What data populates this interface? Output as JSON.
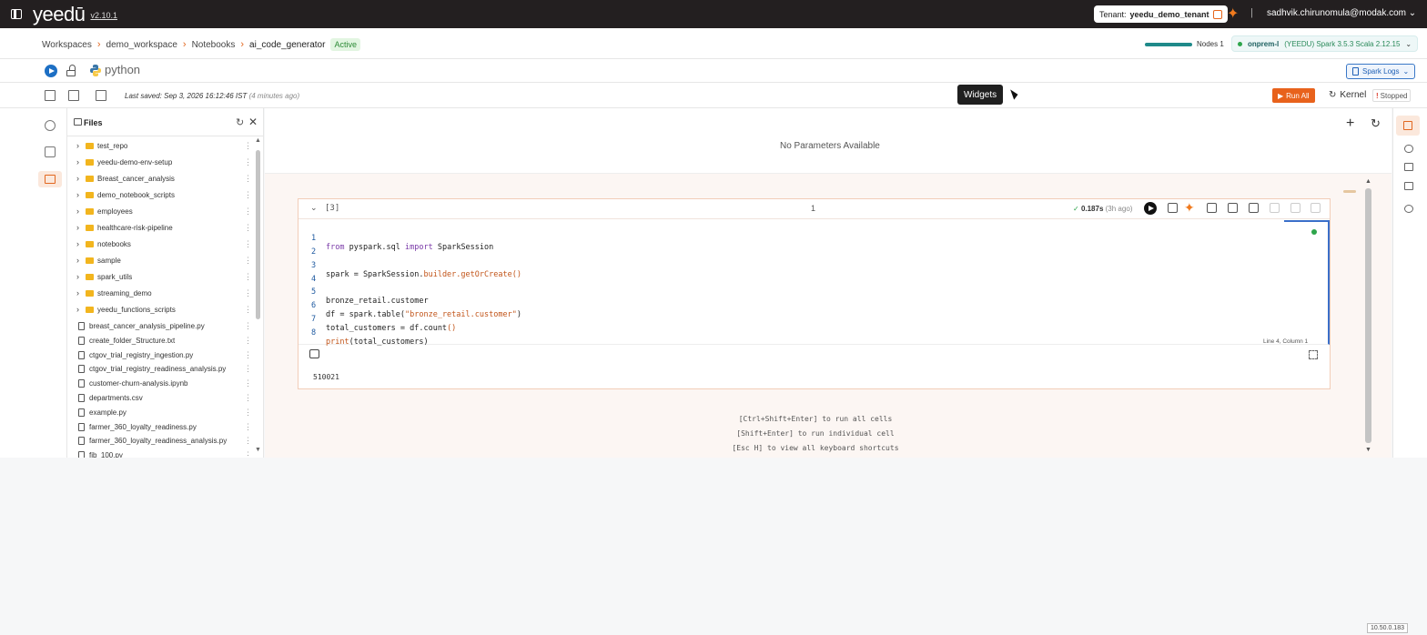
{
  "header": {
    "logo": "yeedū",
    "version": "v2.10.1",
    "tenant_label": "Tenant:",
    "tenant_name": "yeedu_demo_tenant",
    "separator": "|",
    "user": "sadhvik.chirunomula@modak.com",
    "user_caret": "⌄"
  },
  "breadcrumb": {
    "items": [
      "Workspaces",
      "demo_workspace",
      "Notebooks",
      "ai_code_generator"
    ],
    "separator": "›",
    "status": "Active"
  },
  "cluster": {
    "nodes_label": "Nodes 1",
    "name": "onprem-l",
    "version": "(YEEDU) Spark 3.5.3 Scala 2.12.15",
    "caret": "⌄"
  },
  "lang": {
    "label": "python",
    "spark_logs": "Spark Logs",
    "spark_logs_caret": "⌄"
  },
  "toolbar": {
    "last_saved": "Last saved: Sep 3, 2026 16:12:46 IST",
    "ago": "(4 minutes ago)",
    "tooltip": "Widgets",
    "run_all": "Run All",
    "run_all_icon": "▶",
    "kernel": "Kernel",
    "kernel_icon": "↻",
    "stopped": "Stopped",
    "stopped_mark": "!"
  },
  "files": {
    "title": "Files",
    "refresh_glyph": "↻",
    "close_glyph": "✕",
    "folders": [
      "test_repo",
      "yeedu-demo-env-setup",
      "Breast_cancer_analysis",
      "demo_notebook_scripts",
      "employees",
      "healthcare-risk-pipeline",
      "notebooks",
      "sample",
      "spark_utils",
      "streaming_demo",
      "yeedu_functions_scripts"
    ],
    "files": [
      "breast_cancer_analysis_pipeline.py",
      "create_folder_Structure.txt",
      "ctgov_trial_registry_ingestion.py",
      "ctgov_trial_registry_readiness_analysis.py",
      "customer-churn-analysis.ipynb",
      "departments.csv",
      "example.py",
      "farmer_360_loyalty_readiness.py",
      "farmer_360_loyalty_readiness_analysis.py",
      "fib_100.py"
    ],
    "caret": "›",
    "kebab": "⋮",
    "scroll_up": "▲",
    "scroll_down": "▼"
  },
  "params": {
    "empty_text": "No Parameters Available",
    "plus_glyph": "+",
    "reload_glyph": "↻"
  },
  "cell": {
    "collapse_glyph": "⌄",
    "exec_count": "[3]",
    "number": "1",
    "check": "✓",
    "time": "0.187s",
    "time_ago": "(3h ago)",
    "ai_glyph": "✦",
    "cursor_pos": "Line 4,    Column 1",
    "output": "510021",
    "code_line_numbers": [
      "1",
      "2",
      "3",
      "4",
      "5",
      "6",
      "7",
      "8"
    ],
    "code": {
      "l1_kw1": "from",
      "l1_mod": " pyspark.sql ",
      "l1_kw2": "import",
      "l1_rest": " SparkSession",
      "l3_a": "spark = SparkSession.",
      "l3_b": "builder.getOrCreate",
      "l3_c": "()",
      "l5": "bronze_retail.customer",
      "l6_a": "df = spark.table(",
      "l6_str": "\"bronze_retail.customer\"",
      "l6_c": ")",
      "l7_a": "total_customers = df.count",
      "l7_b": "()",
      "l8_fn": "print",
      "l8_rest": "(total_customers)"
    }
  },
  "hints": [
    "[Ctrl+Shift+Enter] to run all cells",
    "[Shift+Enter] to run individual cell",
    "[Esc H] to view all keyboard shortcuts"
  ],
  "scroll": {
    "up": "▲",
    "down": "▼"
  },
  "footer": {
    "ip": "10.50.0.183"
  },
  "colors": {
    "accent": "#e8621c",
    "brand_dark": "#231f20",
    "link_blue": "#1d6fc4",
    "success": "#2ea54b"
  },
  "icons": [
    "sidebar-toggle-icon",
    "external-link-icon",
    "spark-ai-icon",
    "play-icon",
    "unlock-icon",
    "python-logo-icon",
    "file-icon",
    "download-icon",
    "clear-icon",
    "save-icon",
    "database-icon",
    "table-icon",
    "folder-icon",
    "copy-icon",
    "add-cell-icon",
    "upload-icon",
    "arrow-up-icon",
    "arrow-down-icon",
    "trash-icon",
    "output-icon",
    "expand-icon",
    "grid-icon",
    "key-icon",
    "camera-icon",
    "keyboard-icon",
    "history-icon"
  ]
}
